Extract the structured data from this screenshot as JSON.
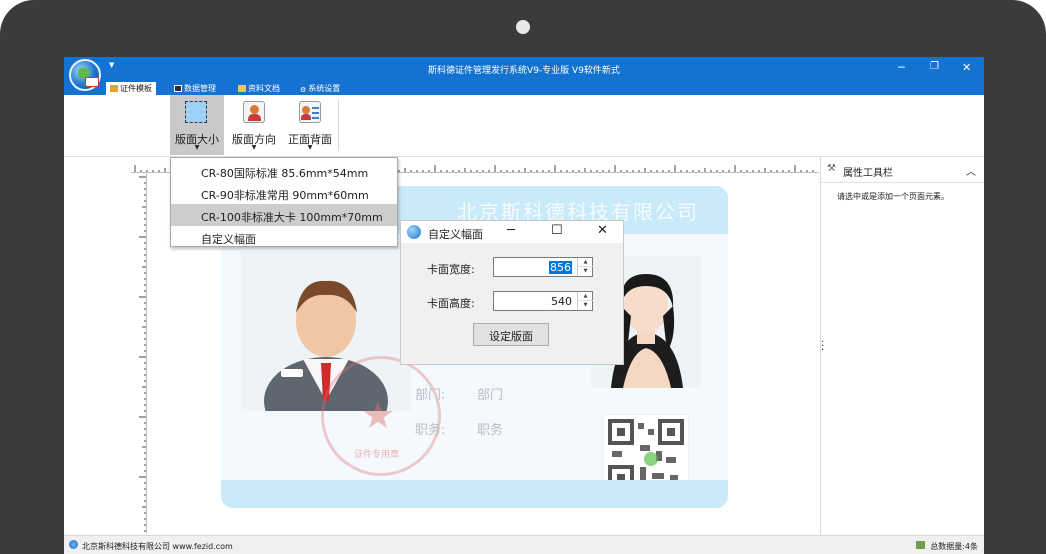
{
  "app": {
    "title": "斯科德证件管理发行系统V9-专业版    V9软件新式",
    "minimize": "─",
    "restore": "❐",
    "close": "✕",
    "quick_access": "▼"
  },
  "tabs": [
    {
      "label": "证件模板",
      "active": true
    },
    {
      "label": "数据管理",
      "active": false
    },
    {
      "label": "资料文档",
      "active": false
    },
    {
      "label": "系统设置",
      "active": false
    }
  ],
  "ribbon": {
    "size_label": "版面大小",
    "orient_label": "版面方向",
    "side_label": "正面背面",
    "dropdown_arrow": "▼"
  },
  "dropdown": {
    "items": [
      {
        "label": "CR-80国际标准 85.6mm*54mm",
        "highlighted": false
      },
      {
        "label": "CR-90非标准常用 90mm*60mm",
        "highlighted": false
      },
      {
        "label": "CR-100非标准大卡 100mm*70mm",
        "highlighted": true
      },
      {
        "label": "自定义幅面",
        "highlighted": false
      }
    ]
  },
  "card": {
    "company": "北京斯科德科技有限公司",
    "dept_label": "部门:",
    "dept_value": "部门",
    "title_label": "职务:",
    "title_value": "职务",
    "seal_text": "证件专用章"
  },
  "dialog": {
    "title": "自定义幅面",
    "minimize": "─",
    "maximize": "☐",
    "close": "✕",
    "width_label": "卡面宽度:",
    "width_value": "856",
    "height_label": "卡面高度:",
    "height_value": "540",
    "confirm": "设定版面"
  },
  "properties": {
    "title": "属性工具栏",
    "collapse": "︿",
    "hint": "请选中或是添加一个页面元素。"
  },
  "status": {
    "left": "北京斯科德科技有限公司    www.fezid.com",
    "right": "总数据量:4条"
  },
  "colors": {
    "title_bar": "#1473d0",
    "selection": "#0078d7",
    "card_band": "#c9eaf8",
    "seal": "#e26e6e"
  }
}
